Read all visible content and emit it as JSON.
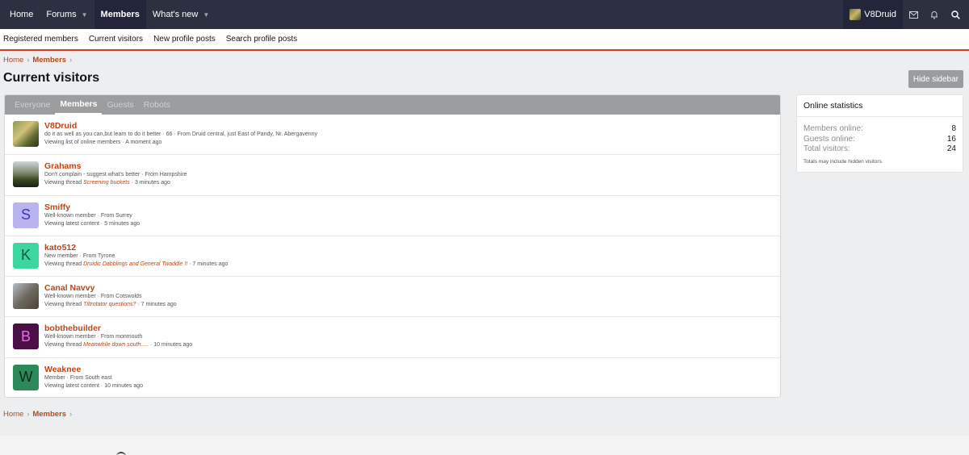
{
  "nav": {
    "tabs": [
      {
        "label": "Home",
        "dropdown": false
      },
      {
        "label": "Forums",
        "dropdown": true
      },
      {
        "label": "Members",
        "dropdown": false,
        "active": true
      },
      {
        "label": "What's new",
        "dropdown": true
      }
    ],
    "username": "V8Druid"
  },
  "subnav": {
    "items": [
      "Registered members",
      "Current visitors",
      "New profile posts",
      "Search profile posts"
    ]
  },
  "breadcrumb": {
    "home": "Home",
    "members": "Members"
  },
  "page": {
    "title": "Current visitors",
    "hide_sidebar": "Hide sidebar"
  },
  "filter_tabs": [
    "Everyone",
    "Members",
    "Guests",
    "Robots"
  ],
  "members": [
    {
      "name": "V8Druid",
      "line1": "do it as well as you can,but learn to do it better · 66 · From Druid central, just East of Pandy, Nr. Abergavenny",
      "line2_pre": "Viewing list of online members · A moment ago",
      "thread": "",
      "line2_post": "",
      "avatar_type": "photo1",
      "letter": ""
    },
    {
      "name": "Grahams",
      "line1": "Don't complain - suggest what's better · From Hampshire",
      "line2_pre": "Viewing thread ",
      "thread": "Screening buckets",
      "line2_post": " · 3 minutes ago",
      "avatar_type": "photo2",
      "letter": ""
    },
    {
      "name": "Smiffy",
      "line1": "Well-known member · From Surrey",
      "line2_pre": "Viewing latest content · 5 minutes ago",
      "thread": "",
      "line2_post": "",
      "avatar_type": "letter",
      "letter": "S",
      "avatar_bg": "#b9b4f0",
      "avatar_fg": "#3d35b8"
    },
    {
      "name": "kato512",
      "line1": "New member · From Tyrone",
      "line2_pre": "Viewing thread ",
      "thread": "Druidic Dabblings and General Twaddle !!",
      "line2_post": " · 7 minutes ago",
      "avatar_type": "letter",
      "letter": "K",
      "avatar_bg": "#3dd6a0",
      "avatar_fg": "#0f5a3e"
    },
    {
      "name": "Canal Navvy",
      "line1": "Well-known member · From Cotswolds",
      "line2_pre": "Viewing thread ",
      "thread": "Tiltrotator questions?",
      "line2_post": " · 7 minutes ago",
      "avatar_type": "photo3",
      "letter": ""
    },
    {
      "name": "bobthebuilder",
      "line1": "Well-known member · From monmouth",
      "line2_pre": "Viewing thread ",
      "thread": "Meanwhile down south.....",
      "line2_post": " · 10 minutes ago",
      "avatar_type": "letter",
      "letter": "B",
      "avatar_bg": "#4a0f47",
      "avatar_fg": "#e66de0"
    },
    {
      "name": "Weaknee",
      "line1": "Member · From South east",
      "line2_pre": "Viewing latest content · 10 minutes ago",
      "thread": "",
      "line2_post": "",
      "avatar_type": "letter",
      "letter": "W",
      "avatar_bg": "#2c8a5a",
      "avatar_fg": "#0a2a18"
    }
  ],
  "sidebar": {
    "title": "Online statistics",
    "stats": [
      {
        "label": "Members online:",
        "value": "8"
      },
      {
        "label": "Guests online:",
        "value": "16"
      },
      {
        "label": "Total visitors:",
        "value": "24"
      }
    ],
    "note": "Totals may include hidden visitors."
  }
}
